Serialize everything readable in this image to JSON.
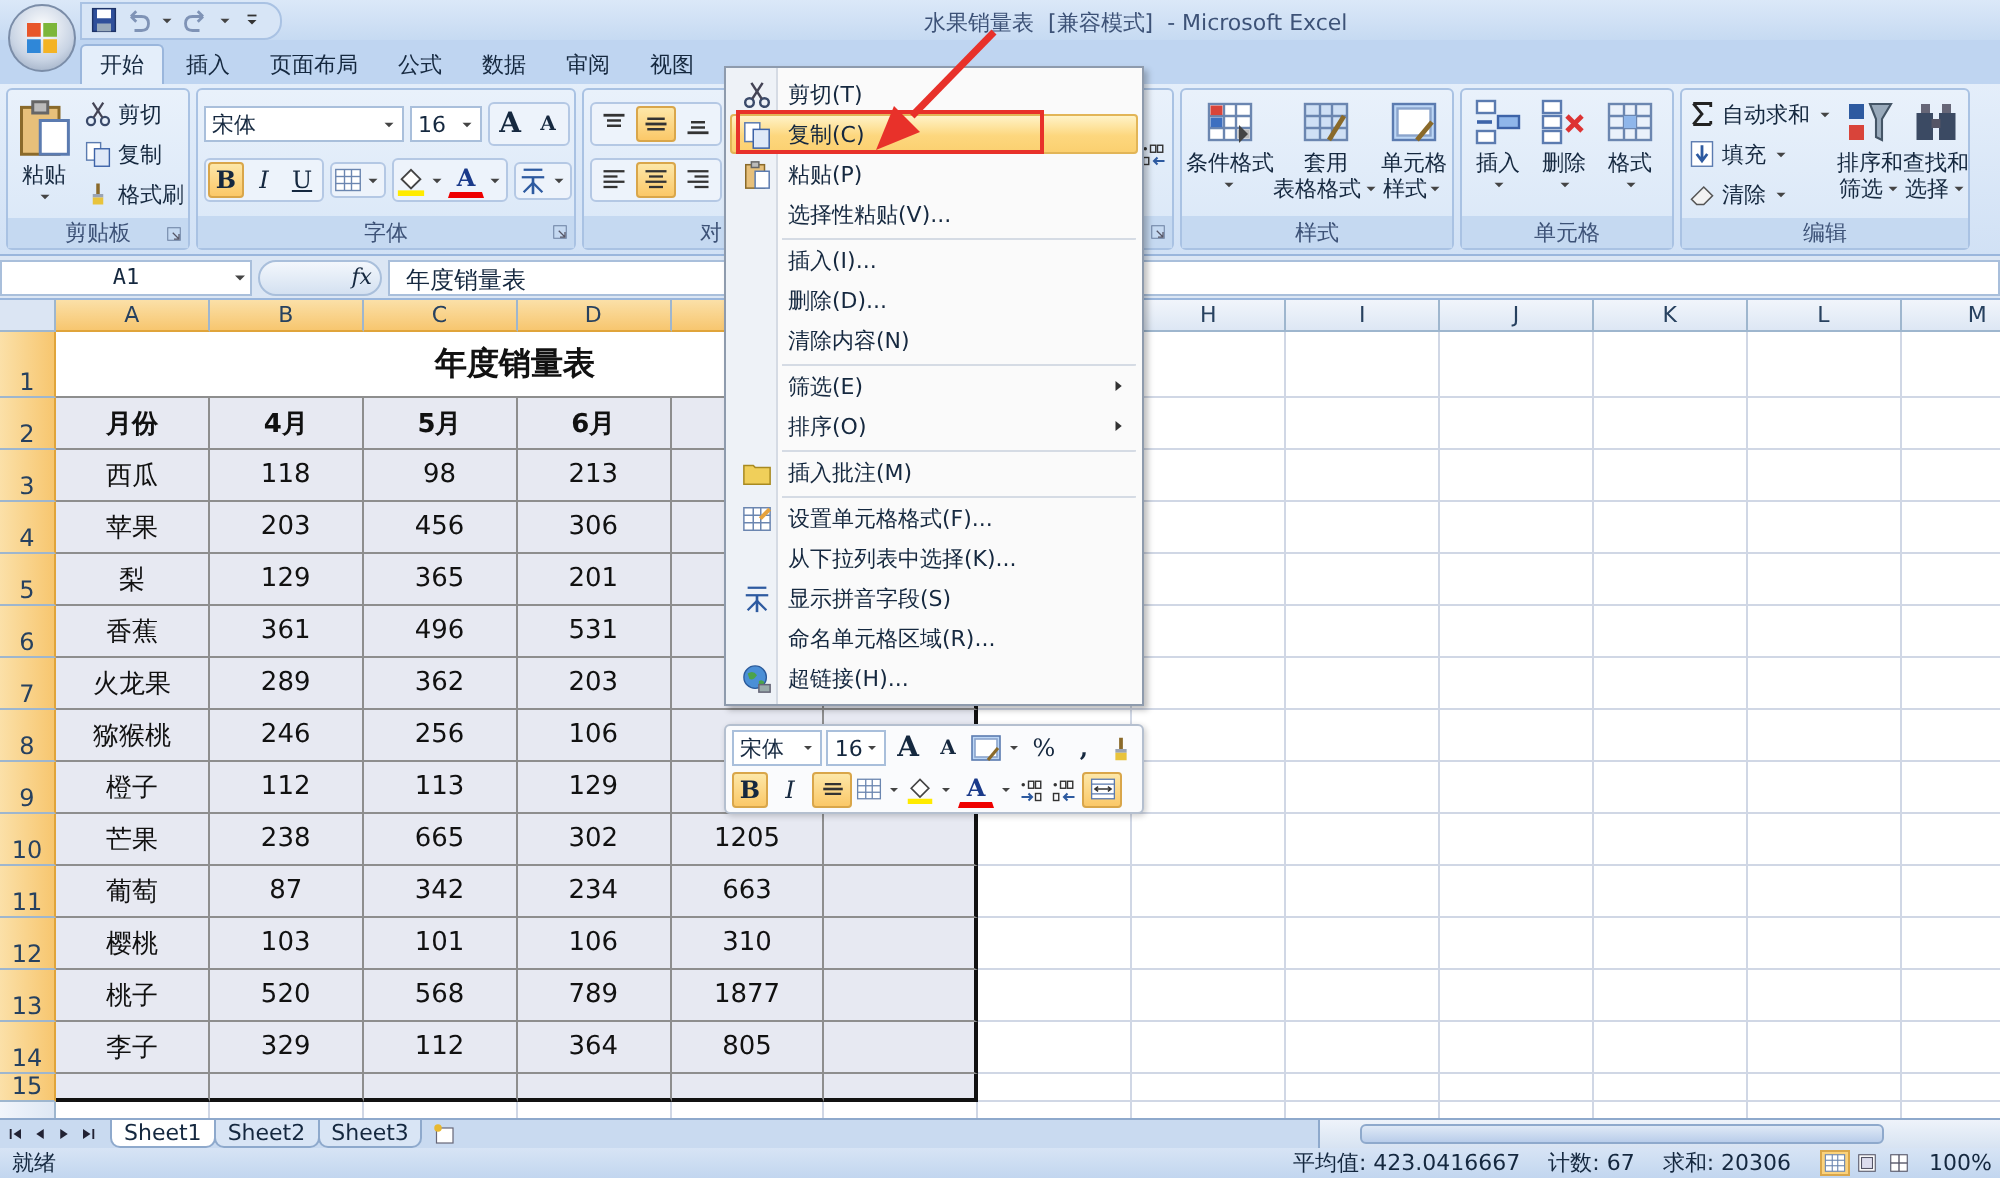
{
  "window": {
    "title": "水果销量表  [兼容模式]  - Microsoft Excel"
  },
  "tabs": [
    {
      "label": "开始",
      "selected": true
    },
    {
      "label": "插入",
      "selected": false
    },
    {
      "label": "页面布局",
      "selected": false
    },
    {
      "label": "公式",
      "selected": false
    },
    {
      "label": "数据",
      "selected": false
    },
    {
      "label": "审阅",
      "selected": false
    },
    {
      "label": "视图",
      "selected": false
    }
  ],
  "ribbon": {
    "clipboard": {
      "label": "剪贴板",
      "paste": "粘贴",
      "actions": [
        "剪切",
        "复制",
        "格式刷"
      ]
    },
    "font": {
      "label": "字体",
      "font_name": "宋体",
      "font_size": "16",
      "grow": "A",
      "shrink": "A",
      "styles": [
        {
          "label": "B",
          "kind": "bold",
          "selected": true
        },
        {
          "label": "I",
          "kind": "italic",
          "selected": false
        },
        {
          "label": "U",
          "kind": "underline",
          "selected": false
        }
      ],
      "font_color": "A"
    },
    "alignment": {
      "label": "对",
      "vertical": [
        {
          "selected": false
        },
        {
          "selected": true
        },
        {
          "selected": false
        }
      ],
      "horizontal": [
        {
          "selected": false
        },
        {
          "selected": true
        },
        {
          "selected": false
        }
      ]
    },
    "styles": {
      "label": "样式",
      "buttons": [
        {
          "lines": [
            "条件格式"
          ]
        },
        {
          "lines": [
            "套用",
            "表格格式"
          ]
        },
        {
          "lines": [
            "单元格",
            "样式"
          ]
        }
      ]
    },
    "cells": {
      "label": "单元格",
      "buttons": [
        "插入",
        "删除",
        "格式"
      ]
    },
    "editing": {
      "label": "编辑",
      "actions": [
        "自动求和",
        "填充",
        "清除"
      ],
      "buttons": [
        {
          "lines": [
            "排序和",
            "筛选"
          ]
        },
        {
          "lines": [
            "查找和",
            "选择"
          ]
        }
      ]
    }
  },
  "formula_bar": {
    "name_box": "A1",
    "fx": "fx",
    "content": "年度销量表"
  },
  "sheet": {
    "columns": [
      {
        "label": "A",
        "selected": true
      },
      {
        "label": "B",
        "selected": true
      },
      {
        "label": "C",
        "selected": true
      },
      {
        "label": "D",
        "selected": true
      },
      {
        "selected": true
      },
      {
        "selected": true
      },
      {},
      {
        "label": "H",
        "selected": false
      },
      {
        "label": "I",
        "selected": false
      },
      {
        "label": "J",
        "selected": false
      },
      {
        "label": "K",
        "selected": false
      },
      {
        "label": "L",
        "selected": false
      },
      {
        "label": "M",
        "selected": false
      }
    ],
    "rows": [
      {
        "number": "1",
        "selected": true,
        "kind": "title",
        "cells": [
          "年度销量表"
        ]
      },
      {
        "number": "2",
        "selected": true,
        "kind": "header",
        "cells": [
          "月份",
          "4月",
          "5月",
          "6月"
        ]
      },
      {
        "number": "3",
        "selected": true,
        "kind": "data",
        "cells": [
          "西瓜",
          "118",
          "98",
          "213"
        ]
      },
      {
        "number": "4",
        "selected": true,
        "kind": "data",
        "cells": [
          "苹果",
          "203",
          "456",
          "306"
        ]
      },
      {
        "number": "5",
        "selected": true,
        "kind": "data",
        "cells": [
          "梨",
          "129",
          "365",
          "201"
        ]
      },
      {
        "number": "6",
        "selected": true,
        "kind": "data",
        "cells": [
          "香蕉",
          "361",
          "496",
          "531"
        ]
      },
      {
        "number": "7",
        "selected": true,
        "kind": "data",
        "cells": [
          "火龙果",
          "289",
          "362",
          "203"
        ]
      },
      {
        "number": "8",
        "selected": true,
        "kind": "data",
        "cells": [
          "猕猴桃",
          "246",
          "256",
          "106"
        ]
      },
      {
        "number": "9",
        "selected": true,
        "kind": "data",
        "cells": [
          "橙子",
          "112",
          "113",
          "129"
        ]
      },
      {
        "number": "10",
        "selected": true,
        "kind": "data",
        "cells": [
          "芒果",
          "238",
          "665",
          "302",
          "1205"
        ]
      },
      {
        "number": "11",
        "selected": true,
        "kind": "data",
        "cells": [
          "葡萄",
          "87",
          "342",
          "234",
          "663"
        ]
      },
      {
        "number": "12",
        "selected": true,
        "kind": "data",
        "cells": [
          "樱桃",
          "103",
          "101",
          "106",
          "310"
        ]
      },
      {
        "number": "13",
        "selected": true,
        "kind": "data",
        "cells": [
          "桃子",
          "520",
          "568",
          "789",
          "1877"
        ]
      },
      {
        "number": "14",
        "selected": true,
        "kind": "data",
        "cells": [
          "李子",
          "329",
          "112",
          "364",
          "805"
        ]
      },
      {
        "number": "15",
        "selected": true,
        "kind": "empty"
      }
    ]
  },
  "sheet_tabs": [
    {
      "label": "Sheet1",
      "selected": true
    },
    {
      "label": "Sheet2",
      "selected": false
    },
    {
      "label": "Sheet3",
      "selected": false
    }
  ],
  "context_menu": {
    "items": [
      {
        "label": "剪切(T)",
        "selected": false,
        "submenu": false,
        "divider": false
      },
      {
        "label": "复制(C)",
        "selected": true,
        "submenu": false,
        "divider": false
      },
      {
        "label": "粘贴(P)",
        "selected": false,
        "submenu": false,
        "divider": false
      },
      {
        "label": "选择性粘贴(V)...",
        "selected": false,
        "submenu": false,
        "divider": true
      },
      {
        "label": "插入(I)...",
        "selected": false,
        "submenu": false,
        "divider": false
      },
      {
        "label": "删除(D)...",
        "selected": false,
        "submenu": false,
        "divider": false
      },
      {
        "label": "清除内容(N)",
        "selected": false,
        "submenu": false,
        "divider": true
      },
      {
        "label": "筛选(E)",
        "selected": false,
        "submenu": true,
        "divider": false
      },
      {
        "label": "排序(O)",
        "selected": false,
        "submenu": true,
        "divider": true
      },
      {
        "label": "插入批注(M)",
        "selected": false,
        "submenu": false,
        "divider": true
      },
      {
        "label": "设置单元格格式(F)...",
        "selected": false,
        "submenu": false,
        "divider": false
      },
      {
        "label": "从下拉列表中选择(K)...",
        "selected": false,
        "submenu": false,
        "divider": false
      },
      {
        "label": "显示拼音字段(S)",
        "selected": false,
        "submenu": false,
        "divider": false
      },
      {
        "label": "命名单元格区域(R)...",
        "selected": false,
        "submenu": false,
        "divider": false
      },
      {
        "label": "超链接(H)...",
        "selected": false,
        "submenu": false,
        "divider": false
      }
    ]
  },
  "mini_toolbar": {
    "font_name": "宋体",
    "font_size": "16",
    "grow": "A",
    "shrink": "A",
    "percent": "%",
    "comma": ",",
    "bold": {
      "label": "B",
      "selected": true
    },
    "italic": {
      "label": "I",
      "selected": false
    },
    "center_selected": true,
    "font_color": "A",
    "merge_selected": true
  },
  "status_bar": {
    "state": "就绪",
    "average": "平均值: 423.0416667",
    "count": "计数: 67",
    "sum": "求和: 20306",
    "views": [
      {
        "selected": true
      },
      {
        "selected": false
      },
      {
        "selected": false
      }
    ],
    "zoom": "100%"
  }
}
